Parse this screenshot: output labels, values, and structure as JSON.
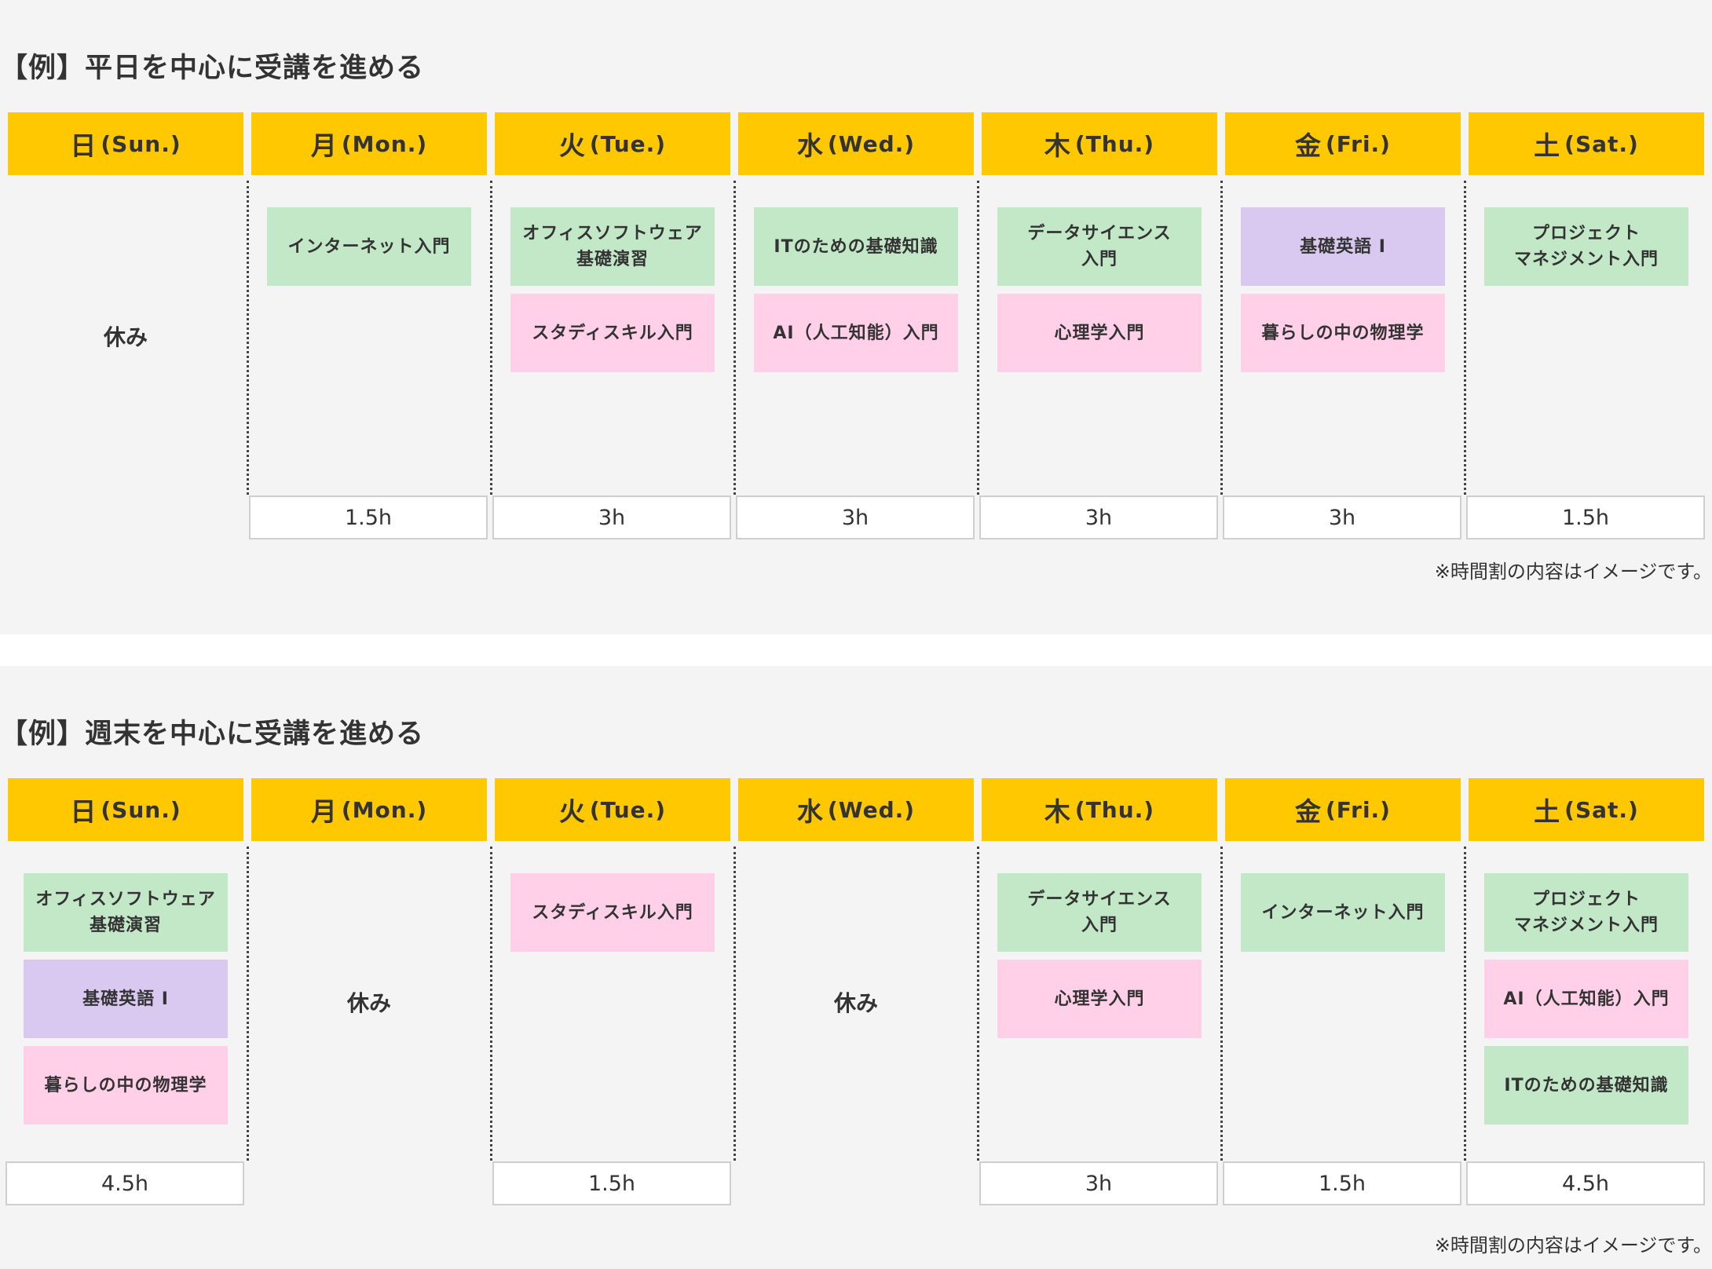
{
  "days": [
    {
      "kanji": "日",
      "en": "(Sun.)"
    },
    {
      "kanji": "月",
      "en": "(Mon.)"
    },
    {
      "kanji": "火",
      "en": "(Tue.)"
    },
    {
      "kanji": "水",
      "en": "(Wed.)"
    },
    {
      "kanji": "木",
      "en": "(Thu.)"
    },
    {
      "kanji": "金",
      "en": "(Fri.)"
    },
    {
      "kanji": "土",
      "en": "(Sat.)"
    }
  ],
  "colors": {
    "header": "#ffc800",
    "green": "#c2e8c8",
    "pink": "#ffd0e8",
    "purple": "#d9c9f0"
  },
  "schedules": [
    {
      "title": "【例】平日を中心に受講を進める",
      "note": "※時間割の内容はイメージです。",
      "columns": [
        {
          "rest": "休み",
          "courses": [],
          "hours": null
        },
        {
          "rest": null,
          "courses": [
            {
              "name": "インターネット入門",
              "color": "green"
            }
          ],
          "hours": "1.5h"
        },
        {
          "rest": null,
          "courses": [
            {
              "name": "オフィスソフトウェア\n基礎演習",
              "color": "green"
            },
            {
              "name": "スタディスキル入門",
              "color": "pink"
            }
          ],
          "hours": "3h"
        },
        {
          "rest": null,
          "courses": [
            {
              "name": "ITのための基礎知識",
              "color": "green"
            },
            {
              "name": "AI（人工知能）入門",
              "color": "pink"
            }
          ],
          "hours": "3h"
        },
        {
          "rest": null,
          "courses": [
            {
              "name": "データサイエンス\n入門",
              "color": "green"
            },
            {
              "name": "心理学入門",
              "color": "pink"
            }
          ],
          "hours": "3h"
        },
        {
          "rest": null,
          "courses": [
            {
              "name": "基礎英語 I",
              "color": "purple"
            },
            {
              "name": "暮らしの中の物理学",
              "color": "pink"
            }
          ],
          "hours": "3h"
        },
        {
          "rest": null,
          "courses": [
            {
              "name": "プロジェクト\nマネジメント入門",
              "color": "green"
            }
          ],
          "hours": "1.5h"
        }
      ]
    },
    {
      "title": "【例】週末を中心に受講を進める",
      "note": "※時間割の内容はイメージです。",
      "columns": [
        {
          "rest": null,
          "courses": [
            {
              "name": "オフィスソフトウェア\n基礎演習",
              "color": "green"
            },
            {
              "name": "基礎英語 I",
              "color": "purple"
            },
            {
              "name": "暮らしの中の物理学",
              "color": "pink"
            }
          ],
          "hours": "4.5h"
        },
        {
          "rest": "休み",
          "courses": [],
          "hours": null
        },
        {
          "rest": null,
          "courses": [
            {
              "name": "スタディスキル入門",
              "color": "pink"
            }
          ],
          "hours": "1.5h"
        },
        {
          "rest": "休み",
          "courses": [],
          "hours": null
        },
        {
          "rest": null,
          "courses": [
            {
              "name": "データサイエンス\n入門",
              "color": "green"
            },
            {
              "name": "心理学入門",
              "color": "pink"
            }
          ],
          "hours": "3h"
        },
        {
          "rest": null,
          "courses": [
            {
              "name": "インターネット入門",
              "color": "green"
            }
          ],
          "hours": "1.5h"
        },
        {
          "rest": null,
          "courses": [
            {
              "name": "プロジェクト\nマネジメント入門",
              "color": "green"
            },
            {
              "name": "AI（人工知能）入門",
              "color": "pink"
            },
            {
              "name": "ITのための基礎知識",
              "color": "green"
            }
          ],
          "hours": "4.5h"
        }
      ]
    }
  ]
}
